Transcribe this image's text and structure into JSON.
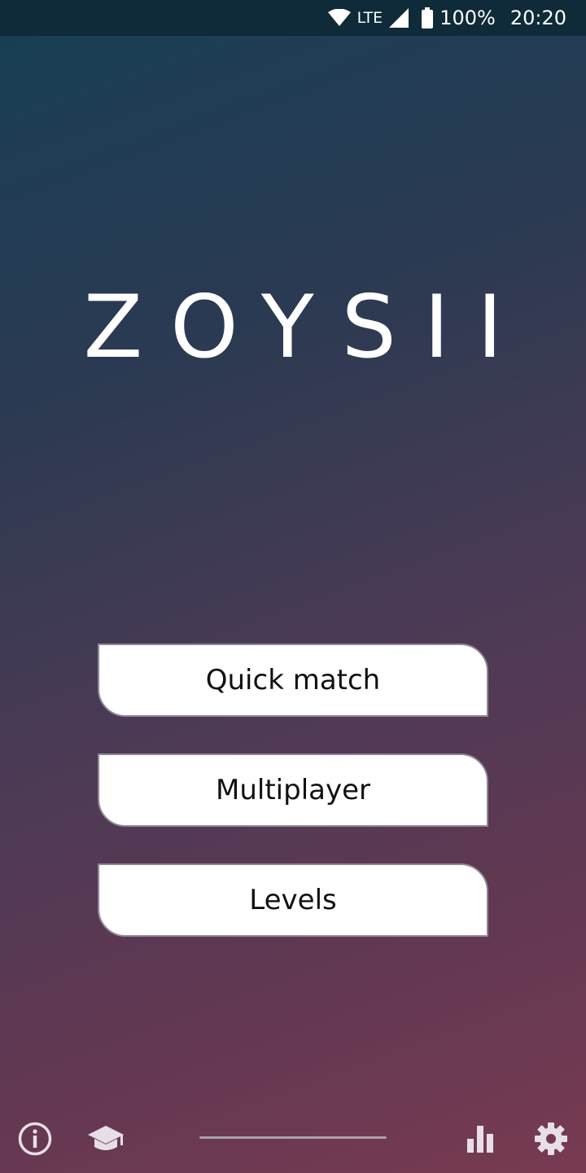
{
  "status_bar": {
    "network": "LTE",
    "battery": "100%",
    "time": "20:20",
    "icons": [
      "wifi-icon",
      "signal-icon",
      "battery-icon"
    ]
  },
  "app": {
    "title": "ZOYSII"
  },
  "menu": {
    "quick_match": "Quick match",
    "multiplayer": "Multiplayer",
    "levels": "Levels"
  },
  "bottom_bar": {
    "icons": [
      "info-icon",
      "tutorial-cap-icon",
      "stats-icon",
      "settings-gear-icon"
    ]
  },
  "colors": {
    "gradient_top": "#173f54",
    "gradient_bottom": "#783a52",
    "button_bg": "#ffffff",
    "icon_color": "#e6dfe8"
  }
}
